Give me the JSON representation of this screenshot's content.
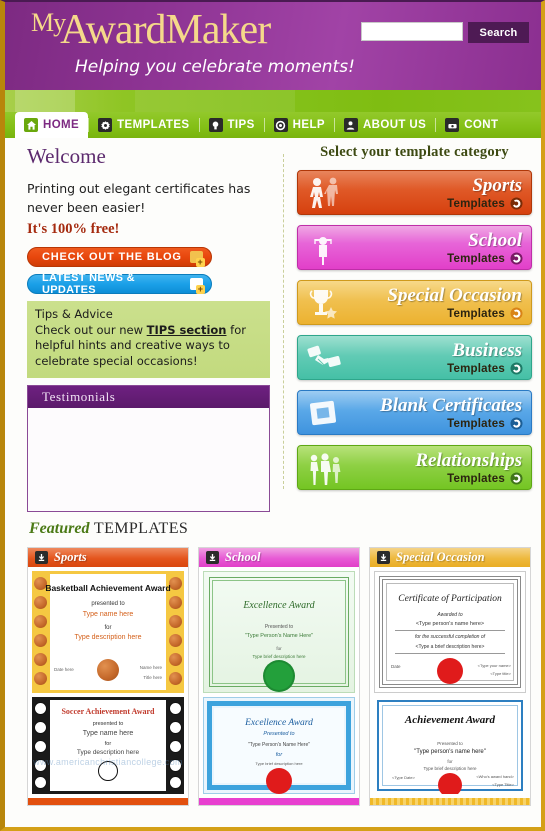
{
  "site": {
    "logo_my": "My",
    "logo_award": "AwardMaker",
    "tagline": "Helping you celebrate moments!"
  },
  "search": {
    "value": "",
    "placeholder": "",
    "button_label": "Search"
  },
  "nav": {
    "items": [
      {
        "label": "HOME",
        "icon": "home-icon",
        "active": true
      },
      {
        "label": "TEMPLATES",
        "icon": "gear-icon",
        "active": false
      },
      {
        "label": "TIPS",
        "icon": "lightbulb-icon",
        "active": false
      },
      {
        "label": "HELP",
        "icon": "lifering-icon",
        "active": false
      },
      {
        "label": "ABOUT US",
        "icon": "person-icon",
        "active": false
      },
      {
        "label": "CONT",
        "icon": "phone-icon",
        "active": false
      }
    ]
  },
  "welcome": {
    "heading": "Welcome",
    "intro": "Printing out elegant certificates has never been easier!",
    "free_line": "It's 100% free!",
    "blog_button": "CHECK OUT THE BLOG",
    "news_button": "LATEST NEWS & UPDATES"
  },
  "tips": {
    "heading": "Tips & Advice",
    "text_before": "Check out our new ",
    "link": "TIPS section",
    "text_after": " for helpful hints and creative ways to celebrate special occasions!"
  },
  "testimonials": {
    "heading": "Testimonials",
    "body": ""
  },
  "categories": {
    "title": "Select your template category",
    "templates_label": "Templates",
    "items": [
      {
        "name": "Sports",
        "color": "#d6400f",
        "icon": "sports-people-icon"
      },
      {
        "name": "School",
        "color": "#e23fc9",
        "icon": "graduate-icon"
      },
      {
        "name": "Special Occasion",
        "color": "#ecb230",
        "icon": "trophy-star-icon"
      },
      {
        "name": "Business",
        "color": "#45c0a6",
        "icon": "handshake-icon"
      },
      {
        "name": "Blank Certificates",
        "color": "#3f93de",
        "icon": "blank-page-icon"
      },
      {
        "name": "Relationships",
        "color": "#74c523",
        "icon": "family-icon"
      }
    ]
  },
  "featured": {
    "title_italic": "Featured",
    "title_plain": "TEMPLATES",
    "cards": [
      {
        "header": "Sports",
        "header_color": "#e4551d",
        "top_cert": {
          "title": "Basketball Achievement Award",
          "presented_to": "presented to",
          "name_field": "Type name here",
          "for_label": "for",
          "desc_field": "Type description here",
          "date_label": "Date here",
          "name_label": "Name here",
          "title_label": "Title here",
          "border": "basketballs"
        },
        "bottom_cert": {
          "title": "Soccer Achievement Award",
          "presented_to": "presented to",
          "name_field": "Type name here",
          "for_label": "for",
          "desc_field": "Type description here",
          "border": "soccerballs",
          "watermark": "www.americanchristiancollege.com"
        }
      },
      {
        "header": "School",
        "header_color": "#e75ad5",
        "top_cert": {
          "title": "Excellence Award",
          "presented_to": "Presented to",
          "name_field": "\"Type Person's Name Here\"",
          "for_label": "for",
          "desc_field": "Type brief description here",
          "seal_color": "#23a03b",
          "border": "green-ornate"
        },
        "bottom_cert": {
          "title": "Excellence Award",
          "presented_to": "Presented to",
          "name_field": "\"Type Person's Name Here\"",
          "for_label": "for",
          "desc_field": "Type brief description here",
          "seal_color": "#e01b1b",
          "border": "blue-band"
        }
      },
      {
        "header": "Special Occasion",
        "header_color": "#eeb93e",
        "top_cert": {
          "title": "Certificate of Participation",
          "presented_to": "Awarded to",
          "name_field": "<Type person's name here>",
          "for_label": "for the successful completion of",
          "desc_field": "<Type a brief description here>",
          "date_label": "Date",
          "name_label": "<Type your name>",
          "title_label": "<Type title>",
          "seal_color": "#e01b1b",
          "border": "grey-ornate"
        },
        "bottom_cert": {
          "title": "Achievement Award",
          "presented_to": "Presented to",
          "name_field": "\"Type person's name here\"",
          "for_label": "for",
          "desc_field": "Type brief description here",
          "date_label": "<Type Date>",
          "name_label": "<Who's award hand>",
          "title_label": "<Type Title>",
          "seal_color": "#e01b1b",
          "border": "blue-frame"
        }
      }
    ]
  },
  "theme": {
    "purple": "#8e3494",
    "green": "#84c017",
    "gold": "#d4a017",
    "accent_red": "#a52a0f"
  }
}
